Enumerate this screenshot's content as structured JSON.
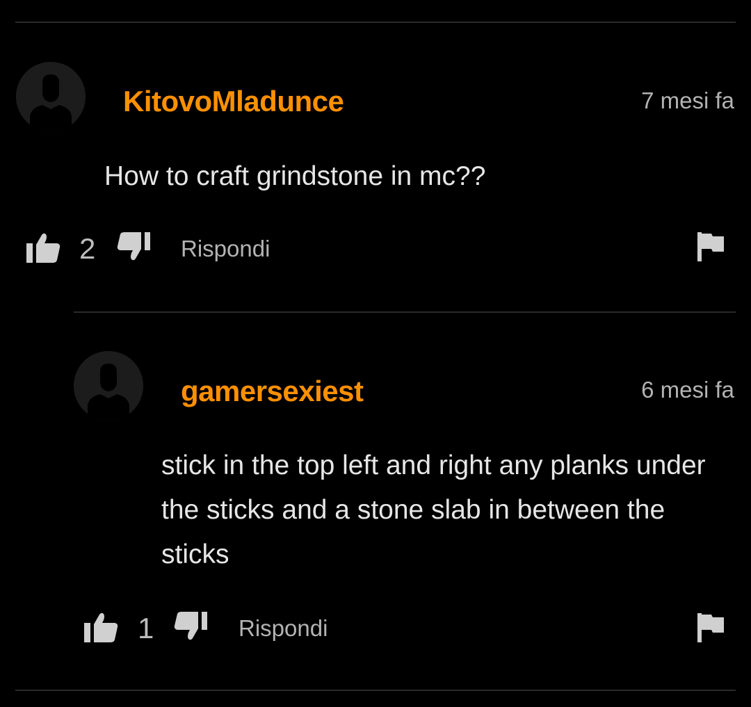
{
  "colors": {
    "accent": "#ff9000",
    "background": "#000000",
    "divider": "#2a2a2a",
    "text": "#e6e6e6",
    "muted": "#b3b3b3"
  },
  "comments": [
    {
      "username": "KitovoMladunce",
      "timestamp": "7 mesi fa",
      "text": "How to craft grindstone in mc??",
      "likes": "2",
      "reply_label": "Rispondi",
      "icons": {
        "avatar": "user-avatar-icon",
        "like": "thumbs-up-icon",
        "dislike": "thumbs-down-icon",
        "report": "flag-icon"
      }
    },
    {
      "username": "gamersexiest",
      "timestamp": "6 mesi fa",
      "text": "stick in the top left and right any planks under the sticks and a stone slab in between the sticks",
      "likes": "1",
      "reply_label": "Rispondi",
      "icons": {
        "avatar": "user-avatar-icon",
        "like": "thumbs-up-icon",
        "dislike": "thumbs-down-icon",
        "report": "flag-icon"
      }
    }
  ]
}
